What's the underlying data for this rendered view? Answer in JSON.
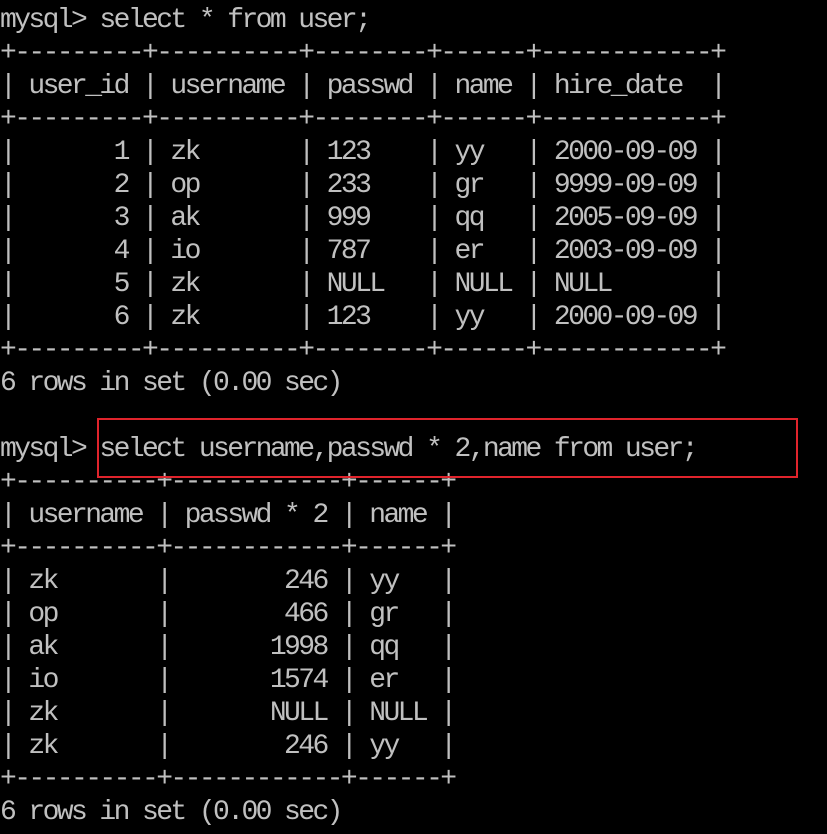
{
  "terminal": {
    "foreground": "#c0c0c0",
    "background": "#000000",
    "highlight_color": "#e0242c",
    "prompt": "mysql> ",
    "lines": [
      "mysql> select * from user;",
      "+---------+----------+--------+------+------------+",
      "| user_id | username | passwd | name | hire_date  |",
      "+---------+----------+--------+------+------------+",
      "|       1 | zk       | 123    | yy   | 2000-09-09 |",
      "|       2 | op       | 233    | gr   | 9999-09-09 |",
      "|       3 | ak       | 999    | qq   | 2005-09-09 |",
      "|       4 | io       | 787    | er   | 2003-09-09 |",
      "|       5 | zk       | NULL   | NULL | NULL       |",
      "|       6 | zk       | 123    | yy   | 2000-09-09 |",
      "+---------+----------+--------+------+------------+",
      "6 rows in set (0.00 sec)",
      "",
      "mysql> select username,passwd * 2,name from user;",
      "+----------+------------+------+",
      "| username | passwd * 2 | name |",
      "+----------+------------+------+",
      "| zk       |        246 | yy   |",
      "| op       |        466 | gr   |",
      "| ak       |       1998 | qq   |",
      "| io       |       1574 | er   |",
      "| zk       |       NULL | NULL |",
      "| zk       |        246 | yy   |",
      "+----------+------------+------+",
      "6 rows in set (0.00 sec)"
    ]
  }
}
